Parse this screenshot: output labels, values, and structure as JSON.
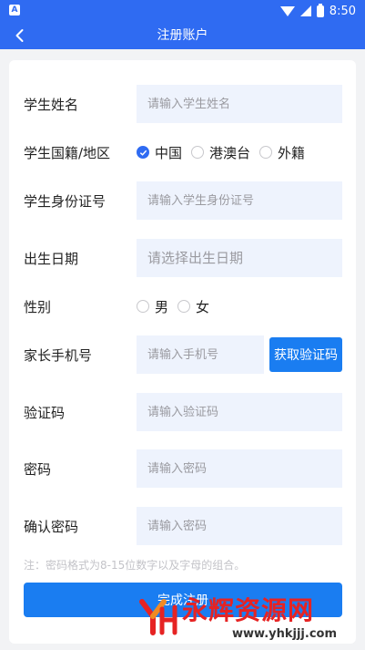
{
  "status_bar": {
    "time": "8:50",
    "sim_label": "A"
  },
  "nav": {
    "title": "注册账户",
    "back_icon": "chevron-left-icon"
  },
  "form": {
    "student_name": {
      "label": "学生姓名",
      "placeholder": "请输入学生姓名",
      "value": ""
    },
    "nationality": {
      "label": "学生国籍/地区",
      "options": [
        "中国",
        "港澳台",
        "外籍"
      ],
      "selected": "中国"
    },
    "id_number": {
      "label": "学生身份证号",
      "placeholder": "请输入学生身份证号",
      "value": ""
    },
    "birth_date": {
      "label": "出生日期",
      "placeholder": "请选择出生日期",
      "value": ""
    },
    "gender": {
      "label": "性别",
      "options": [
        "男",
        "女"
      ],
      "selected": ""
    },
    "parent_phone": {
      "label": "家长手机号",
      "placeholder": "请输入手机号",
      "value": "",
      "code_button": "获取验证码"
    },
    "verify_code": {
      "label": "验证码",
      "placeholder": "请输入验证码",
      "value": ""
    },
    "password": {
      "label": "密码",
      "placeholder": "请输入密码",
      "value": ""
    },
    "confirm_password": {
      "label": "确认密码",
      "placeholder": "请输入密码",
      "value": ""
    },
    "note": "注：密码格式为8-15位数字以及字母的组合。",
    "submit_label": "完成注册"
  },
  "colors": {
    "primary": "#2f6bf2",
    "button": "#1a7df1",
    "input_bg": "#eef3fd"
  },
  "watermark": {
    "text": "永辉资源网",
    "url": "www.yhkjjj.com"
  }
}
